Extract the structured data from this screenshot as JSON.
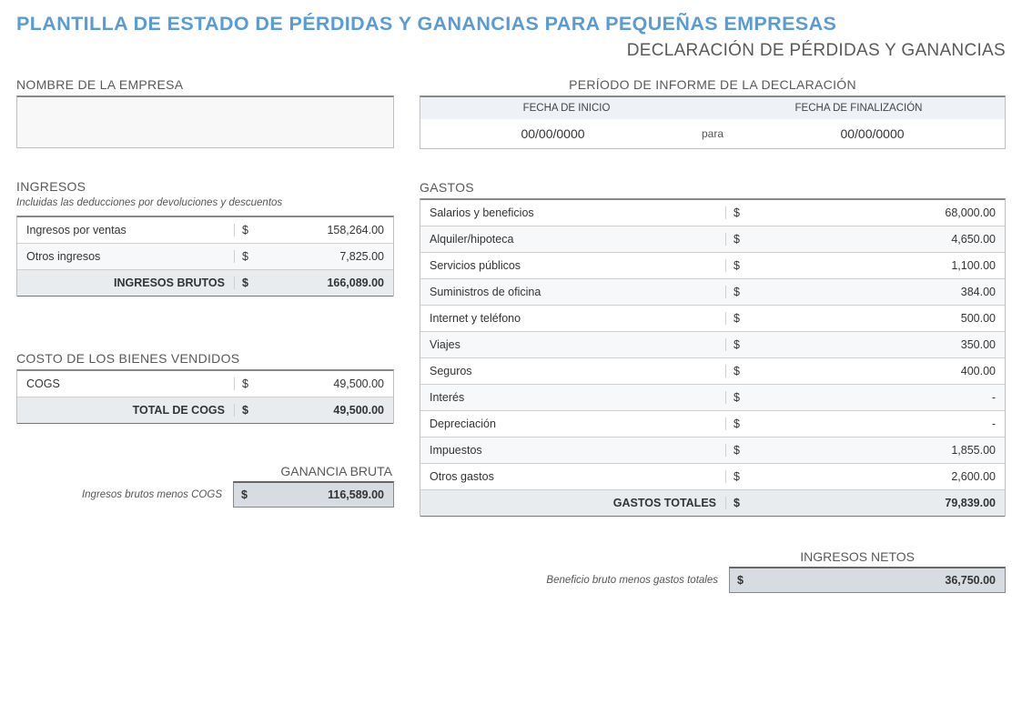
{
  "title": "PLANTILLA DE ESTADO DE PÉRDIDAS Y GANANCIAS PARA PEQUEÑAS EMPRESAS",
  "subtitle": "DECLARACIÓN DE PÉRDIDAS Y GANANCIAS",
  "company_label": "NOMBRE DE LA EMPRESA",
  "period": {
    "label": "PERÍODO DE INFORME DE LA DECLARACIÓN",
    "start_label": "FECHA DE INICIO",
    "end_label": "FECHA DE FINALIZACIÓN",
    "start": "00/00/0000",
    "end": "00/00/0000",
    "separator": "para"
  },
  "currency": "$",
  "ingresos": {
    "label": "INGRESOS",
    "note": "Incluidas las deducciones por devoluciones y descuentos",
    "rows": [
      {
        "label": "Ingresos por ventas",
        "value": "158,264.00"
      },
      {
        "label": "Otros ingresos",
        "value": "7,825.00"
      }
    ],
    "total_label": "INGRESOS BRUTOS",
    "total_value": "166,089.00"
  },
  "cogs": {
    "label": "COSTO DE LOS BIENES VENDIDOS",
    "rows": [
      {
        "label": "COGS",
        "value": "49,500.00"
      }
    ],
    "total_label": "TOTAL DE COGS",
    "total_value": "49,500.00"
  },
  "ganancia_bruta": {
    "label": "GANANCIA BRUTA",
    "note": "Ingresos brutos menos COGS",
    "value": "116,589.00"
  },
  "gastos": {
    "label": "GASTOS",
    "rows": [
      {
        "label": "Salarios y beneficios",
        "value": "68,000.00"
      },
      {
        "label": "Alquiler/hipoteca",
        "value": "4,650.00"
      },
      {
        "label": "Servicios públicos",
        "value": "1,100.00"
      },
      {
        "label": "Suministros de oficina",
        "value": "384.00"
      },
      {
        "label": "Internet y teléfono",
        "value": "500.00"
      },
      {
        "label": "Viajes",
        "value": "350.00"
      },
      {
        "label": "Seguros",
        "value": "400.00"
      },
      {
        "label": "Interés",
        "value": "-"
      },
      {
        "label": "Depreciación",
        "value": "-"
      },
      {
        "label": "Impuestos",
        "value": "1,855.00"
      },
      {
        "label": "Otros gastos",
        "value": "2,600.00"
      }
    ],
    "total_label": "GASTOS TOTALES",
    "total_value": "79,839.00"
  },
  "netos": {
    "label": "INGRESOS NETOS",
    "note": "Beneficio bruto menos gastos totales",
    "value": "36,750.00"
  }
}
